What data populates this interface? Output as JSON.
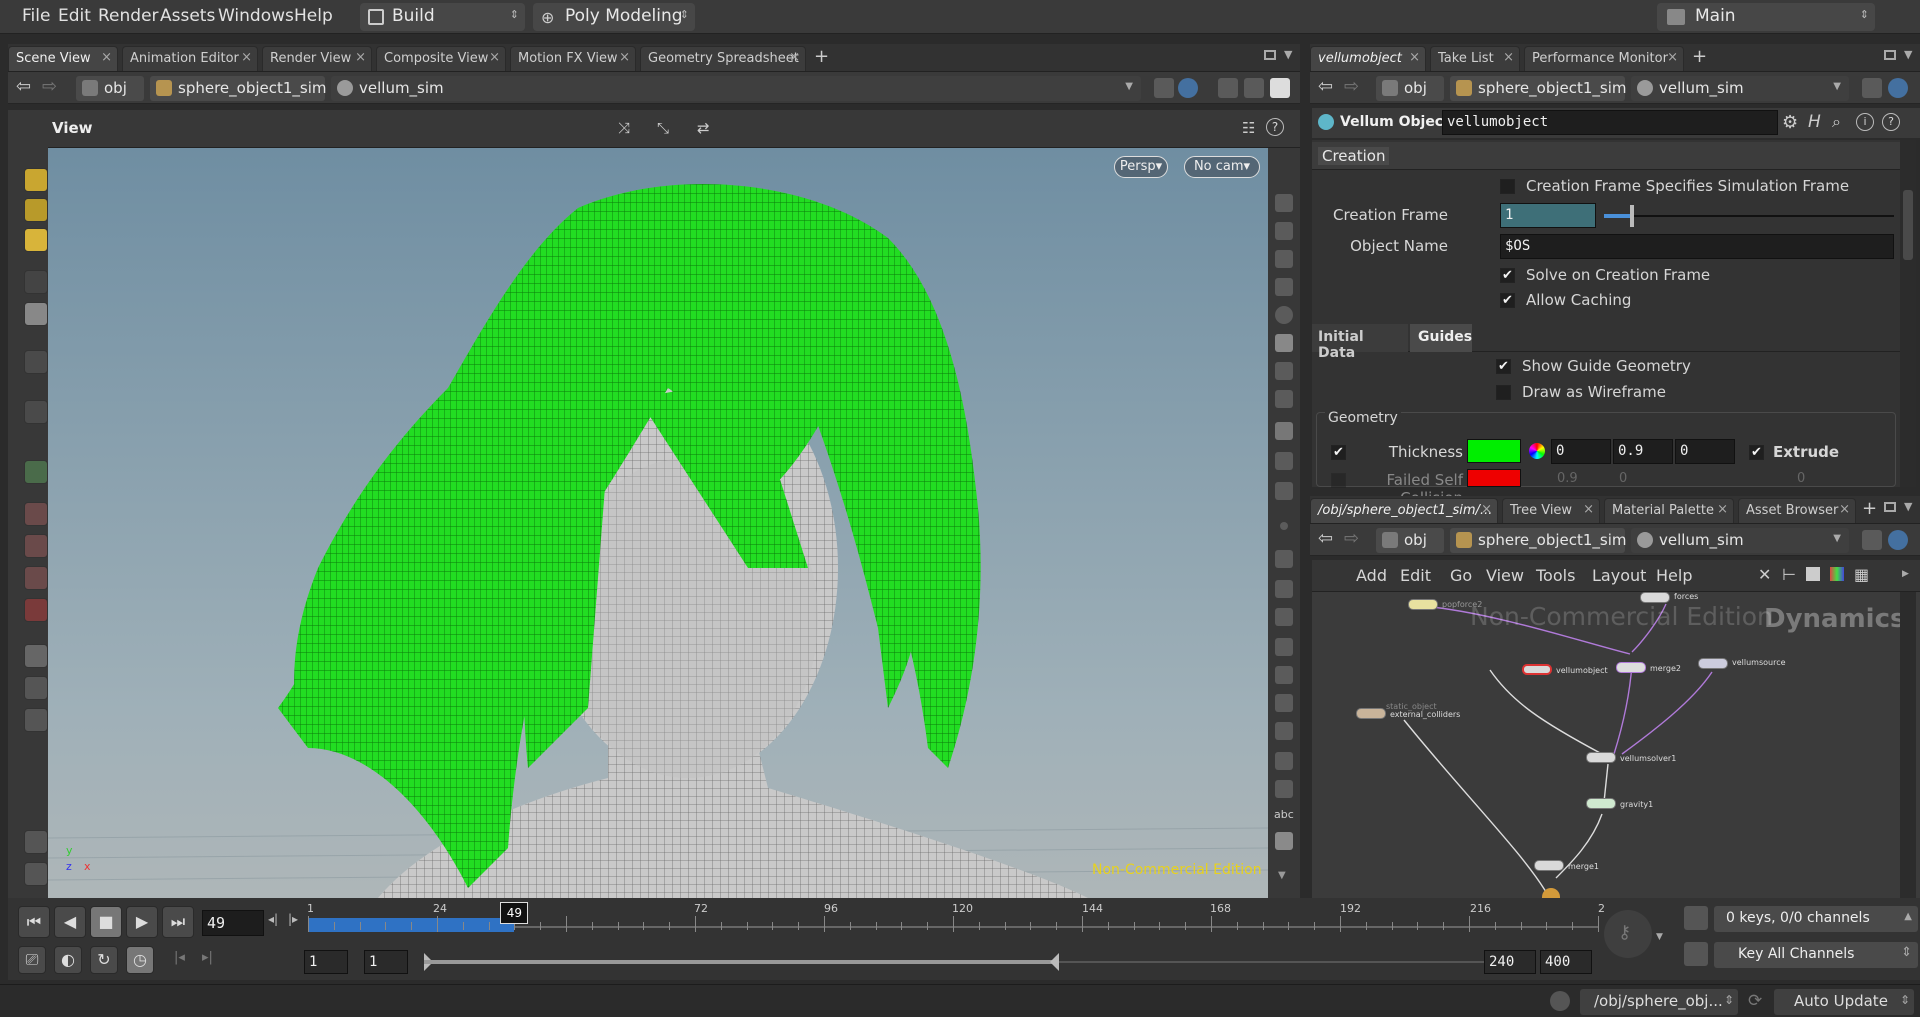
{
  "menubar": {
    "items": [
      "File",
      "Edit",
      "Render",
      "Assets",
      "Windows",
      "Help"
    ],
    "desktop": "Build",
    "shelf": "Poly Modeling",
    "context": "Main"
  },
  "left_tabs": [
    "Scene View",
    "Animation Editor",
    "Render View",
    "Composite View",
    "Motion FX View",
    "Geometry Spreadsheet"
  ],
  "path": {
    "obj": "obj",
    "sim": "sphere_object1_sim",
    "node": "vellum_sim"
  },
  "viewer": {
    "title": "View",
    "persp": "Persp",
    "cam": "No cam",
    "watermark": "Non-Commercial Edition",
    "axis_x": "x",
    "axis_y": "y",
    "axis_z": "z"
  },
  "right_tabs": [
    "vellumobject",
    "Take List",
    "Performance Monitor"
  ],
  "params": {
    "node_type": "Vellum Object",
    "node_name": "vellumobject",
    "section_creation": "Creation",
    "creation_frame_sim_label": "Creation Frame Specifies Simulation Frame",
    "creation_frame_label": "Creation Frame",
    "creation_frame_value": "1",
    "object_name_label": "Object Name",
    "object_name_value": "$OS",
    "solve_on_creation": "Solve on Creation Frame",
    "allow_caching": "Allow Caching",
    "tab_initial": "Initial Data",
    "tab_guides": "Guides",
    "show_guide": "Show Guide Geometry",
    "draw_wireframe": "Draw as Wireframe",
    "geometry_label": "Geometry",
    "thickness_label": "Thickness",
    "thickness_v1": "0",
    "thickness_v2": "0.9",
    "thickness_v3": "0",
    "extrude_label": "Extrude",
    "failed_label": "Failed Self Collision",
    "failed_v1": "0.9",
    "failed_v2": "0",
    "failed_v3": "0",
    "thickness_color": "#00ee00",
    "failed_color": "#ee0000"
  },
  "network_tabs": [
    "/obj/sphere_object1_sim/...",
    "Tree View",
    "Material Palette",
    "Asset Browser"
  ],
  "network_menu": [
    "Add",
    "Edit",
    "Go",
    "View",
    "Tools",
    "Layout",
    "Help"
  ],
  "network": {
    "watermark": "Non-Commercial Edition",
    "context_label": "Dynamics",
    "nodes": {
      "forces": "forces",
      "vellumobject": "vellumobject",
      "merge2": "merge2",
      "vellumsource": "vellumsource",
      "external_colliders": "external_colliders",
      "vellumsolver1": "vellumsolver1",
      "gravity1": "gravity1",
      "merge1": "merge1",
      "popforce": "popforce2",
      "static_object": "static_object"
    }
  },
  "timeline": {
    "current_frame": "49",
    "ticks": [
      "1",
      "24",
      "49",
      "72",
      "96",
      "120",
      "144",
      "168",
      "192",
      "216",
      "2"
    ],
    "range_start": "1",
    "range_start2": "1",
    "range_end": "240",
    "range_end2": "400",
    "progress": 0.2,
    "keys": "0 keys, 0/0 channels",
    "key_all": "Key All Channels"
  },
  "status": {
    "path": "/obj/sphere_obj...",
    "update": "Auto Update"
  }
}
